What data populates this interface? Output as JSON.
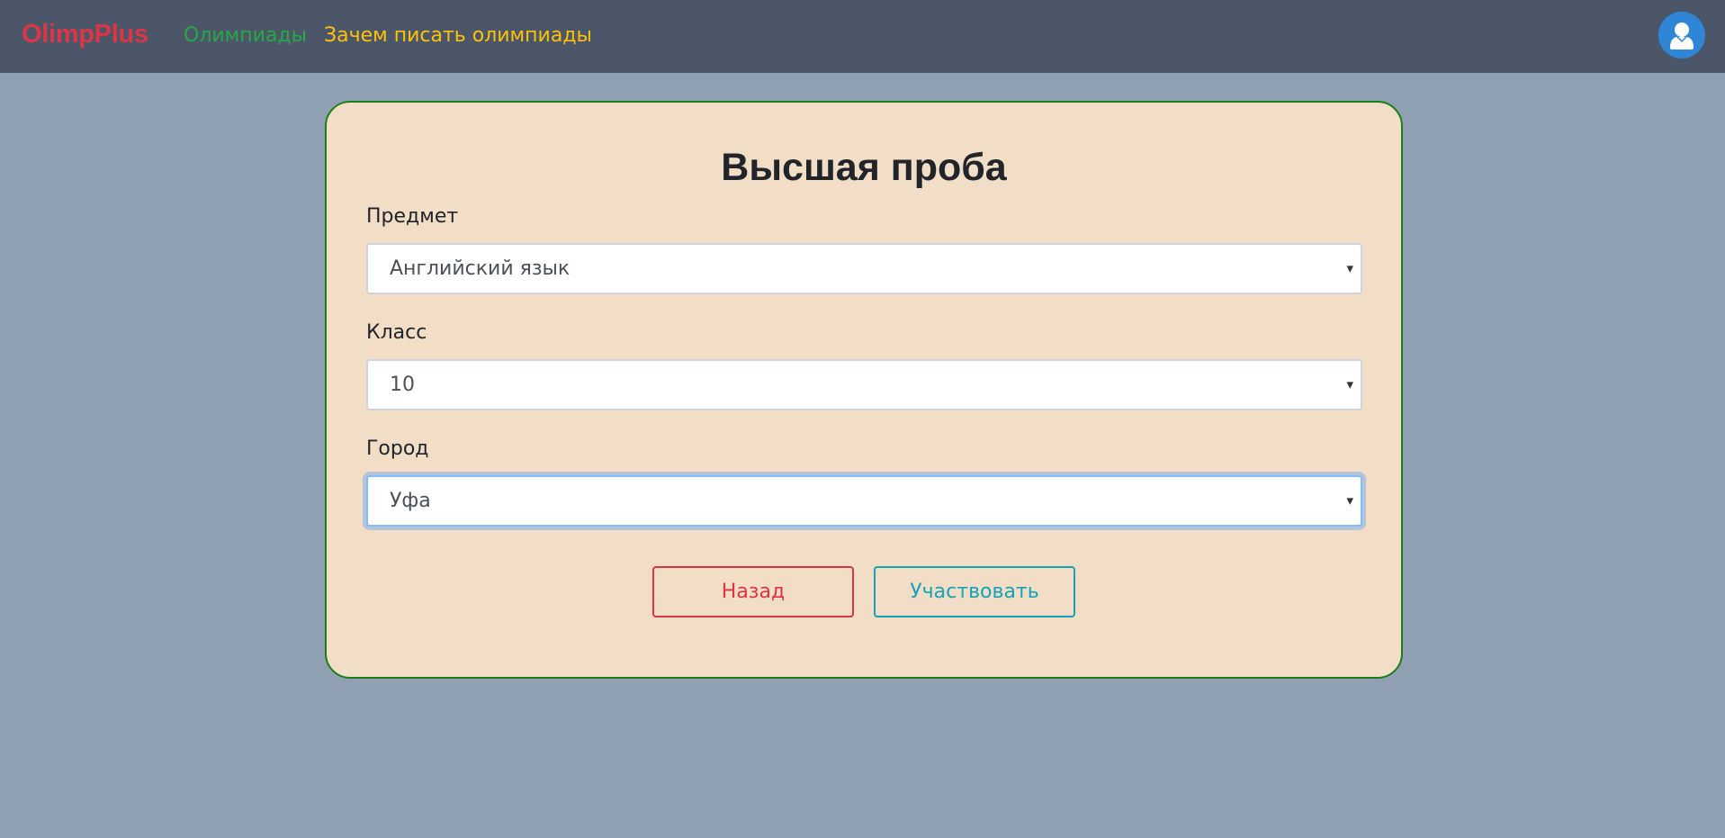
{
  "navbar": {
    "brand": "OlimpPlus",
    "links": [
      {
        "label": "Олимпиады",
        "color": "#28a745"
      },
      {
        "label": "Зачем писать олимпиады",
        "color": "#ffc107"
      }
    ],
    "avatar_icon": "user-icon"
  },
  "form": {
    "title": "Высшая проба",
    "fields": [
      {
        "label": "Предмет",
        "value": "Английский язык"
      },
      {
        "label": "Класс",
        "value": "10"
      },
      {
        "label": "Город",
        "value": "Уфа"
      }
    ],
    "caret_icon": "▾",
    "buttons": {
      "back": "Назад",
      "participate": "Участвовать"
    }
  }
}
